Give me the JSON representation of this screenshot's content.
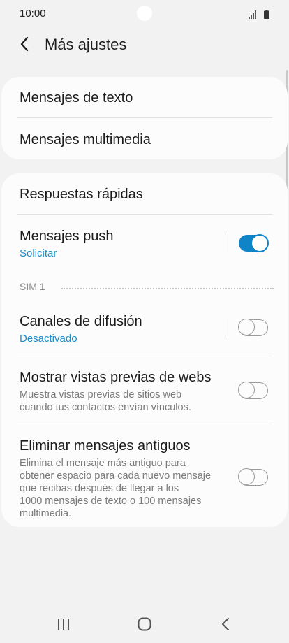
{
  "status": {
    "time": "10:00"
  },
  "header": {
    "title": "Más ajustes"
  },
  "card1": {
    "items": [
      {
        "title": "Mensajes de texto"
      },
      {
        "title": "Mensajes multimedia"
      }
    ]
  },
  "card2": {
    "quick_replies": {
      "title": "Respuestas rápidas"
    },
    "push": {
      "title": "Mensajes push",
      "value": "Solicitar",
      "enabled": true
    },
    "section_label": "SIM 1",
    "broadcast": {
      "title": "Canales de difusión",
      "value": "Desactivado",
      "enabled": false
    },
    "web_preview": {
      "title": "Mostrar vistas previas de webs",
      "desc_lines": [
        "Muestra vistas previas de sitios web",
        "cuando tus contactos envían vínculos."
      ],
      "enabled": false
    },
    "delete_old": {
      "title": "Eliminar mensajes antiguos",
      "desc_lines": [
        "Elimina el mensaje más antiguo para",
        "obtener espacio para cada nuevo mensaje",
        "que recibas después de llegar a los",
        "1000 mensajes de texto o 100 mensajes",
        "multimedia."
      ],
      "enabled": false
    }
  },
  "colors": {
    "accent": "#0f84c6",
    "link": "#1a8cc7",
    "background": "#f2f2f2",
    "card": "#fcfcfc"
  },
  "icons": {
    "back": "back-arrow-icon",
    "signal": "signal-icon",
    "battery": "battery-icon",
    "nav_recents": "recent-apps-icon",
    "nav_home": "home-icon",
    "nav_back": "back-icon"
  }
}
